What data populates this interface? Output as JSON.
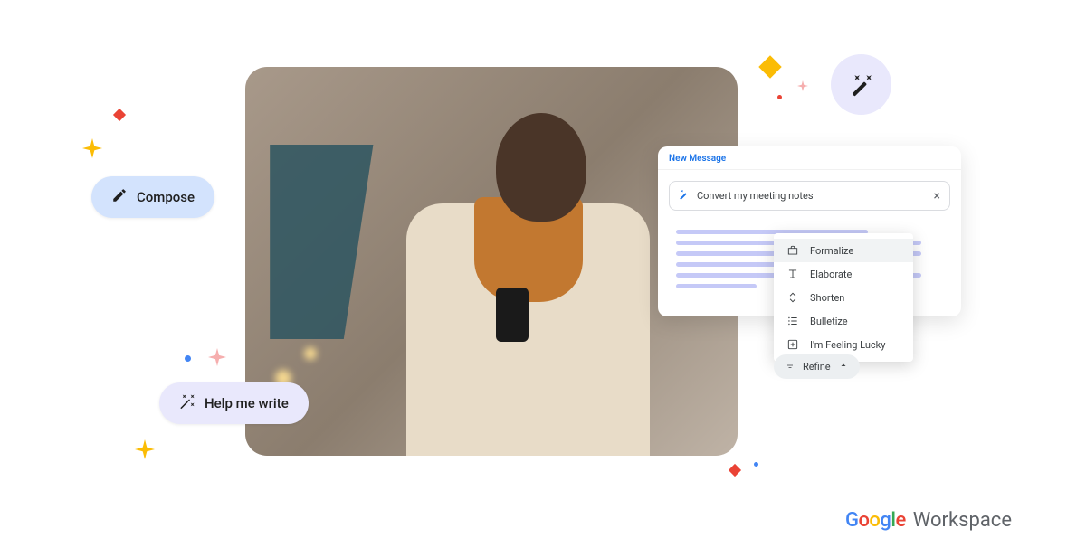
{
  "compose": {
    "label": "Compose"
  },
  "help_me_write": {
    "label": "Help me write"
  },
  "message_panel": {
    "header": "New Message",
    "prompt": "Convert my meeting notes"
  },
  "dropdown": {
    "items": [
      {
        "label": "Formalize"
      },
      {
        "label": "Elaborate"
      },
      {
        "label": "Shorten"
      },
      {
        "label": "Bulletize"
      },
      {
        "label": "I'm Feeling Lucky"
      }
    ]
  },
  "refine": {
    "label": "Refine"
  },
  "brand": {
    "product": "Workspace"
  }
}
